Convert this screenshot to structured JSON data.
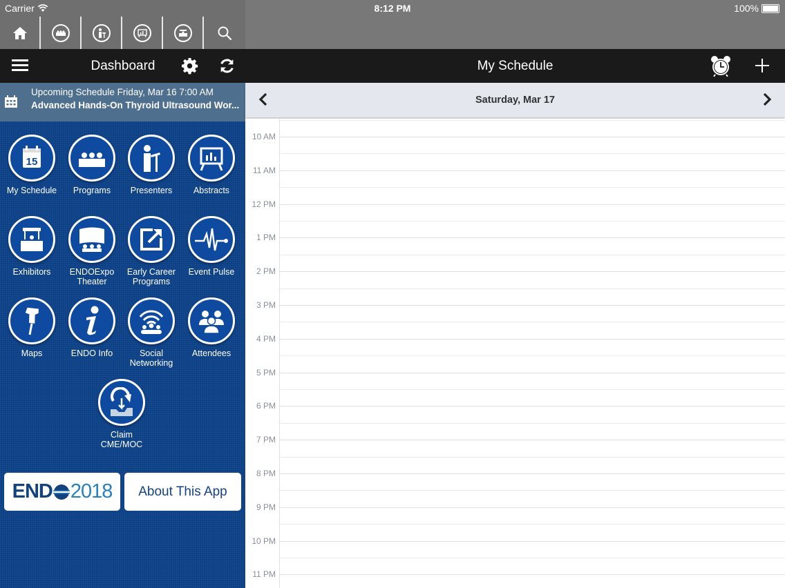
{
  "status_bar": {
    "carrier": "Carrier",
    "time": "8:12 PM",
    "battery": "100%"
  },
  "toolbar": {
    "items": [
      {
        "name": "home",
        "icon": "home-icon"
      },
      {
        "name": "programs",
        "icon": "programs-icon"
      },
      {
        "name": "presenters",
        "icon": "presenter-icon"
      },
      {
        "name": "abstracts",
        "icon": "abstracts-icon"
      },
      {
        "name": "exhibitors",
        "icon": "exhibitor-icon"
      },
      {
        "name": "search",
        "icon": "search-icon"
      }
    ]
  },
  "left_header": {
    "title": "Dashboard"
  },
  "right_header": {
    "title": "My Schedule"
  },
  "upcoming": {
    "line1": "Upcoming Schedule Friday, Mar 16 7:00 AM",
    "line2": "Advanced Hands-On Thyroid Ultrasound Wor..."
  },
  "dashboard": {
    "tiles": [
      {
        "label": "My Schedule",
        "icon": "calendar-15-icon"
      },
      {
        "label": "Programs",
        "icon": "programs-icon"
      },
      {
        "label": "Presenters",
        "icon": "presenter-icon"
      },
      {
        "label": "Abstracts",
        "icon": "abstracts-icon"
      },
      {
        "label": "Exhibitors",
        "icon": "exhibitor-booth-icon"
      },
      {
        "label": "ENDOExpo\nTheater",
        "icon": "theater-icon"
      },
      {
        "label": "Early Career\nPrograms",
        "icon": "external-link-icon"
      },
      {
        "label": "Event Pulse",
        "icon": "pulse-icon"
      },
      {
        "label": "Maps",
        "icon": "pushpin-icon"
      },
      {
        "label": "ENDO Info",
        "icon": "info-icon"
      },
      {
        "label": "Social\nNetworking",
        "icon": "social-icon"
      },
      {
        "label": "Attendees",
        "icon": "attendees-icon"
      },
      {
        "label": "Claim\nCME/MOC",
        "icon": "claim-icon"
      }
    ]
  },
  "buttons": {
    "endo_logo_text_bold": "END",
    "endo_logo_year": "2018",
    "about": "About This App"
  },
  "schedule": {
    "date": "Saturday, Mar 17",
    "hours": [
      "10 AM",
      "11 AM",
      "12 PM",
      "1 PM",
      "2 PM",
      "3 PM",
      "4 PM",
      "5 PM",
      "6 PM",
      "7 PM",
      "8 PM",
      "9 PM",
      "10 PM",
      "11 PM"
    ]
  },
  "colors": {
    "dashboard_bg": "#0b3f86",
    "banner_bg": "#4f6f8e",
    "header_bg": "#1a1a1a",
    "status_bg": "#787878"
  }
}
